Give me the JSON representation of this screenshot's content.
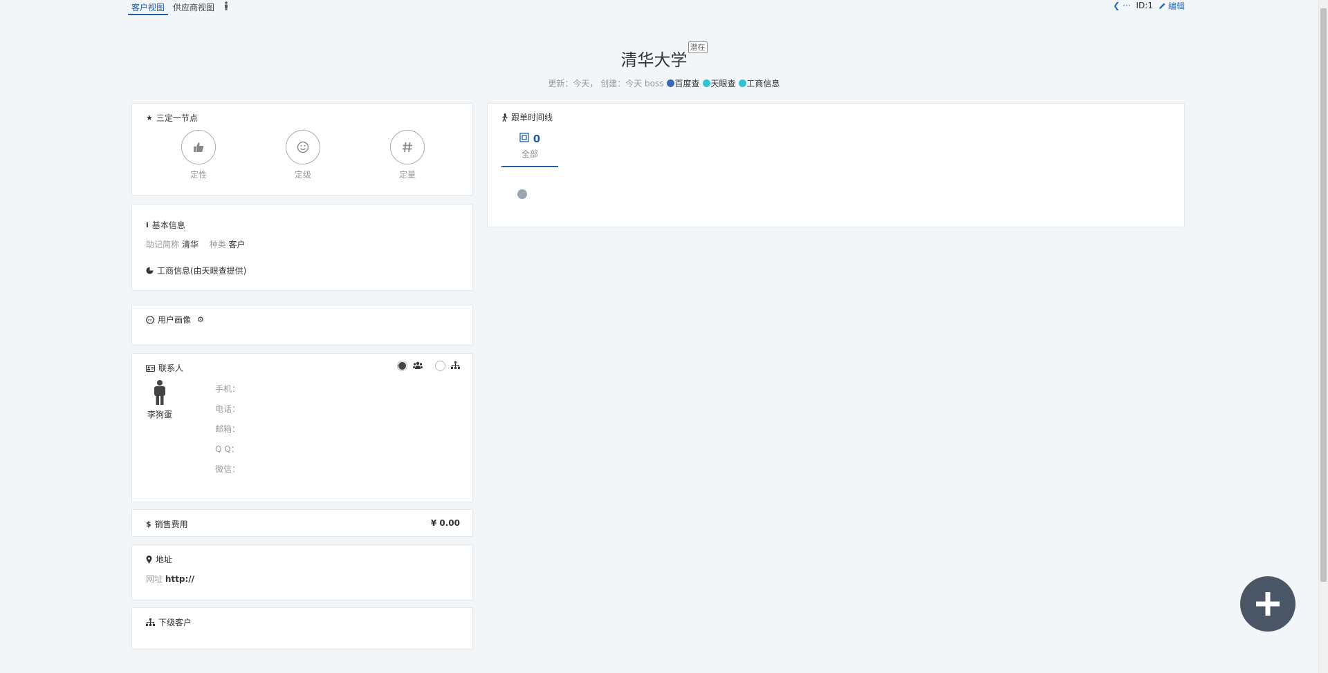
{
  "tabs": [
    {
      "label": "客户视图",
      "active": true
    },
    {
      "label": "供应商视图",
      "active": false
    }
  ],
  "top_right": {
    "back_label": "···",
    "id_label": "ID:1",
    "edit_label": "编辑"
  },
  "header": {
    "title": "清华大学",
    "status_badge": "潜在",
    "meta_text": "更新：今天，  创建：今天 boss",
    "links": [
      "百度查",
      "天眼查",
      "工商信息"
    ]
  },
  "nodes_panel": {
    "title": "三定一节点",
    "items": [
      {
        "label": "定性",
        "icon": "thumbs-up-icon"
      },
      {
        "label": "定级",
        "icon": "smile-icon"
      },
      {
        "label": "定量",
        "icon": "hash-icon"
      }
    ]
  },
  "basic_info": {
    "title": "基本信息",
    "mnemonic_label": "助记简称",
    "mnemonic_value": "清华",
    "type_label": "种类",
    "type_value": "客户",
    "business_info": "工商信息(由天眼查提供)"
  },
  "user_portrait": {
    "title": "用户画像"
  },
  "contacts": {
    "title": "联系人",
    "person_name": "李狗蛋",
    "fields": [
      "手机：",
      "电话：",
      "邮箱：",
      "Q Q：",
      "微信："
    ]
  },
  "sales_cost": {
    "title": "销售费用",
    "amount": "¥  0.00"
  },
  "address": {
    "title": "地址",
    "website_label": "网址",
    "website_value": "http://"
  },
  "sub_customers": {
    "title": "下级客户"
  },
  "timeline": {
    "title": "跟单时间线",
    "count": "0",
    "tab_label": "全部"
  },
  "colors": {
    "accent": "#1f5da4",
    "fab": "#4a5565",
    "background": "#f3f6f9"
  }
}
